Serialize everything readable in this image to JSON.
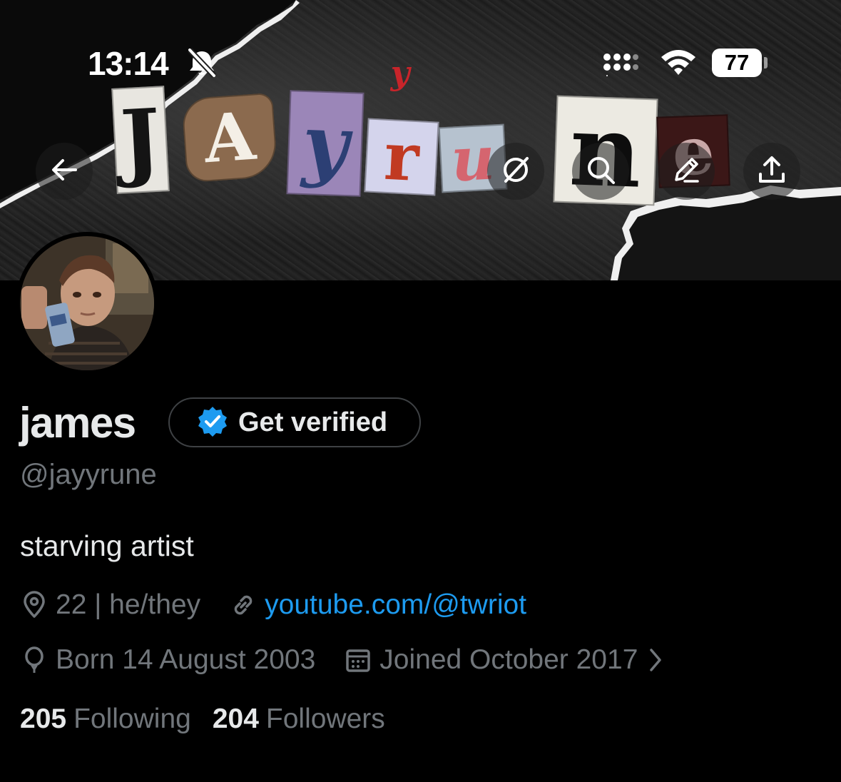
{
  "status_bar": {
    "time": "13:14",
    "icons": [
      "bell-slash-icon",
      "signal-icon",
      "wifi-icon",
      "battery-icon"
    ],
    "battery_level": "77"
  },
  "banner": {
    "title_letters": [
      "J",
      "A",
      "y",
      "y",
      "r",
      "u",
      "n",
      "e"
    ],
    "colors": {
      "background": "#1f1f1f",
      "torn_paper": "#f2f2f2"
    }
  },
  "nav": {
    "back_icon": "arrow-left-icon",
    "grok_icon": "grok-icon",
    "search_icon": "search-icon",
    "edit_icon": "pencil-icon",
    "share_icon": "share-icon"
  },
  "profile": {
    "name": "james",
    "verify_label": "Get verified",
    "handle": "@jayyrune",
    "bio": "starving artist",
    "location": "22 | he/they",
    "website": "youtube.com/@twriot",
    "birthday": "Born 14 August 2003",
    "joined": "Joined October 2017",
    "following_count": "205",
    "following_label": "Following",
    "followers_count": "204",
    "followers_label": "Followers"
  },
  "colors": {
    "text_primary": "#e7e9ea",
    "text_secondary": "#71767b",
    "link": "#1d9bf0",
    "verified_badge": "#1d9bf0",
    "background": "#000000"
  }
}
